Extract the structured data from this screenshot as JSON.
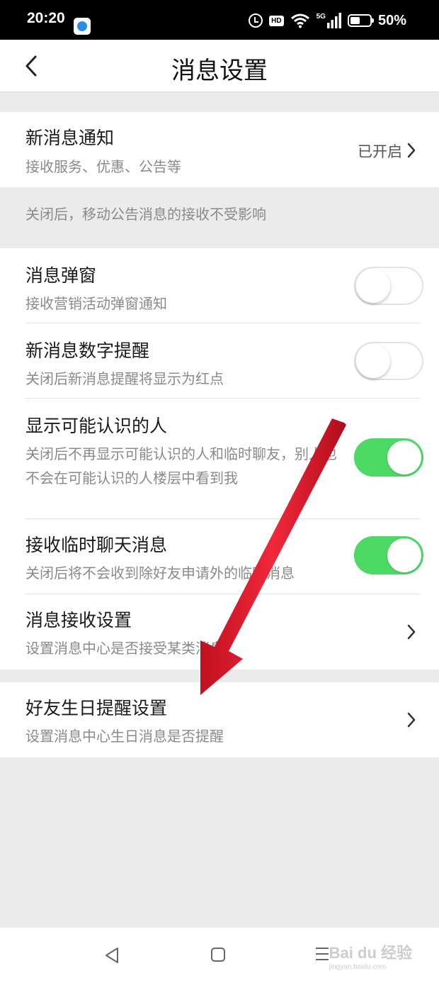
{
  "status_bar": {
    "time": "20:20",
    "hd_label": "HD",
    "signal_label": "5G",
    "battery_pct": "50%",
    "battery_level": 0.5
  },
  "header": {
    "title": "消息设置"
  },
  "settings": {
    "new_msg": {
      "title": "新消息通知",
      "subtitle": "接收服务、优惠、公告等",
      "value": "已开启"
    },
    "hint": "关闭后，移动公告消息的接收不受影响",
    "popup": {
      "title": "消息弹窗",
      "subtitle": "接收营销活动弹窗通知",
      "enabled": false
    },
    "badge": {
      "title": "新消息数字提醒",
      "subtitle": "关闭后新消息提醒将显示为红点",
      "enabled": false
    },
    "maybe_known": {
      "title": "显示可能认识的人",
      "subtitle": "关闭后不再显示可能认识的人和临时聊友，别人也不会在可能认识的人楼层中看到我",
      "enabled": true
    },
    "temp_chat": {
      "title": "接收临时聊天消息",
      "subtitle": "关闭后将不会收到除好友申请外的临时消息",
      "enabled": true
    },
    "receive": {
      "title": "消息接收设置",
      "subtitle": "设置消息中心是否接受某类消息"
    },
    "birthday": {
      "title": "好友生日提醒设置",
      "subtitle": "设置消息中心生日消息是否提醒"
    }
  },
  "watermark": {
    "brand": "Bai du 经验",
    "url": "jingyan.baidu.com"
  },
  "colors": {
    "toggle_on": "#4cd964",
    "arrow": "#e8192c",
    "background": "#ebebeb"
  }
}
